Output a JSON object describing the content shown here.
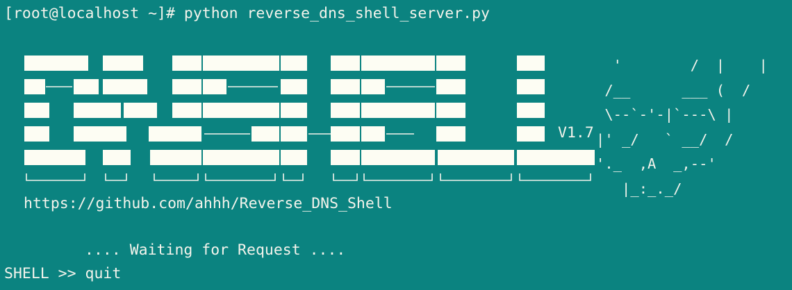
{
  "terminal": {
    "command_line": "[root@localhost ~]# python reverse_dns_shell_server.py",
    "version": "V1.7",
    "shell_ascii_art": "  '        /  |    |\n /__      ___ (  /\n \\--`-'-|`---\\ |\n|' _/   ` __/  /\n'._  ,A  _,--'\n   |_:_._/",
    "url": "https://github.com/ahhh/Reverse_DNS_Shell",
    "waiting_text": ".... Waiting for Request ....",
    "prompt": "SHELL >> ",
    "typed_input": "quit"
  },
  "colors": {
    "background": "#0b8380",
    "foreground": "#f4f4ec"
  }
}
